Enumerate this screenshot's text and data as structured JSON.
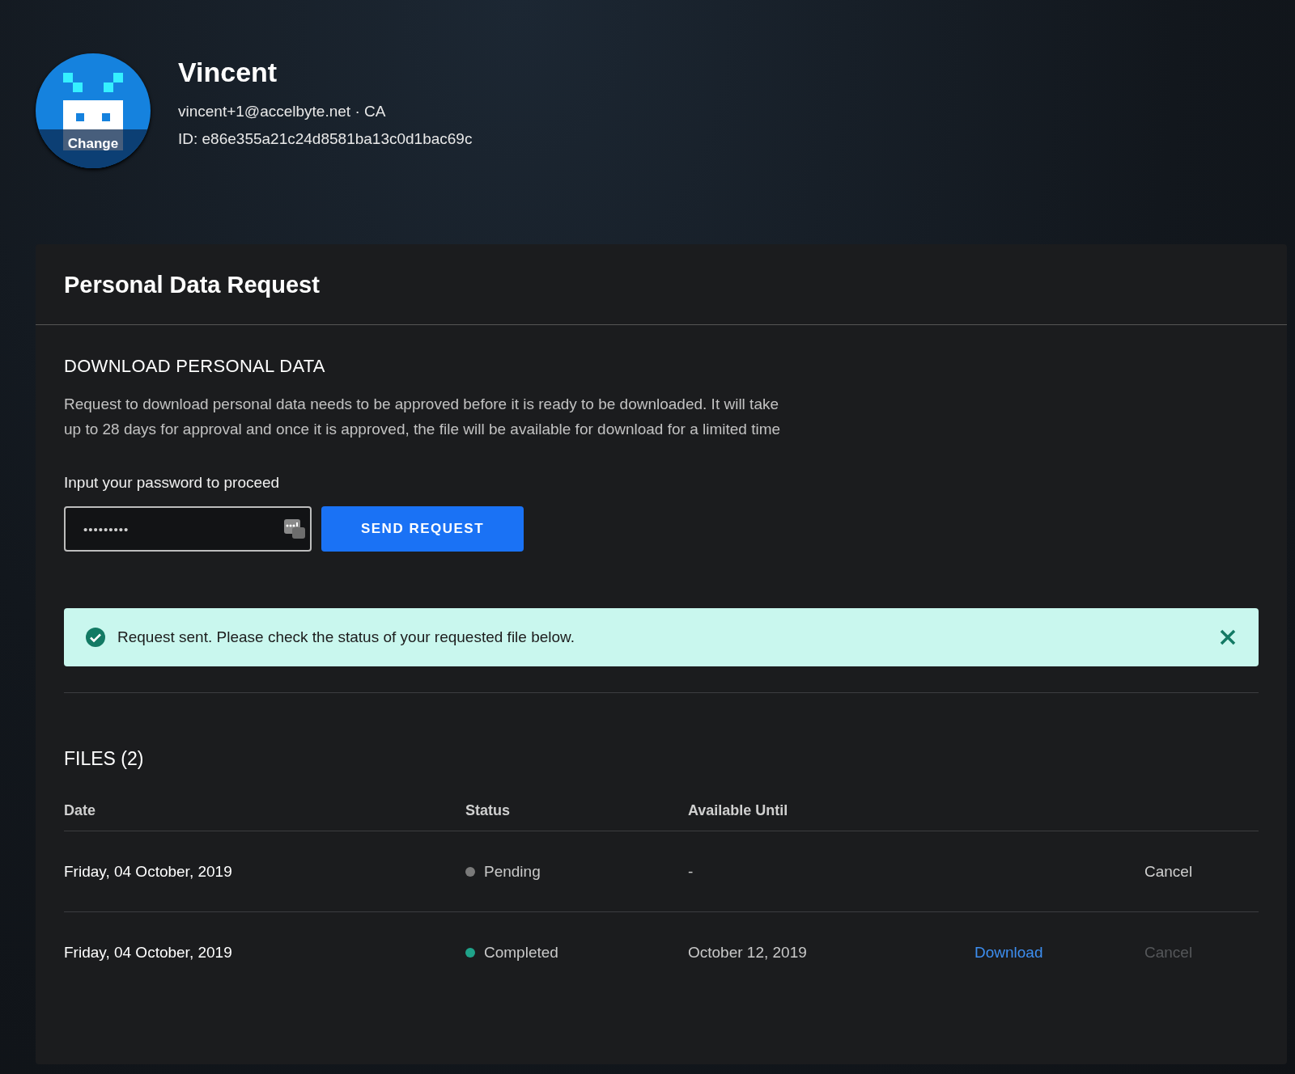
{
  "profile": {
    "name": "Vincent",
    "avatar_action": "Change",
    "contact": "vincent+1@accelbyte.net · CA",
    "id": "ID: e86e355a21c24d8581ba13c0d1bac69c"
  },
  "card": {
    "title": "Personal Data Request",
    "section_title": "DOWNLOAD PERSONAL DATA",
    "description": "Request to download personal data needs to be approved before it is ready to be downloaded. It will take up to 28 days for approval and once it is approved, the file will be available for download for a limited time",
    "password_label": "Input your password to proceed",
    "password_value": "•••••••••",
    "submit_button": "SEND REQUEST",
    "alert": {
      "message": "Request sent. Please check the status of your requested file below."
    },
    "files_title": "FILES (2)",
    "table": {
      "columns": [
        "Date",
        "Status",
        "Available Until"
      ],
      "rows": [
        {
          "date": "Friday, 04 October, 2019",
          "status": "Pending",
          "color": "#7a7a7a",
          "available_until": "-",
          "cancel": {
            "label": "Cancel",
            "disabled": false
          }
        },
        {
          "date": "Friday, 04 October, 2019",
          "status": "Completed",
          "color": "#1fa38a",
          "available_until": "October 12, 2019",
          "download": "Download",
          "cancel": {
            "label": "Cancel",
            "disabled": true
          }
        }
      ]
    }
  }
}
